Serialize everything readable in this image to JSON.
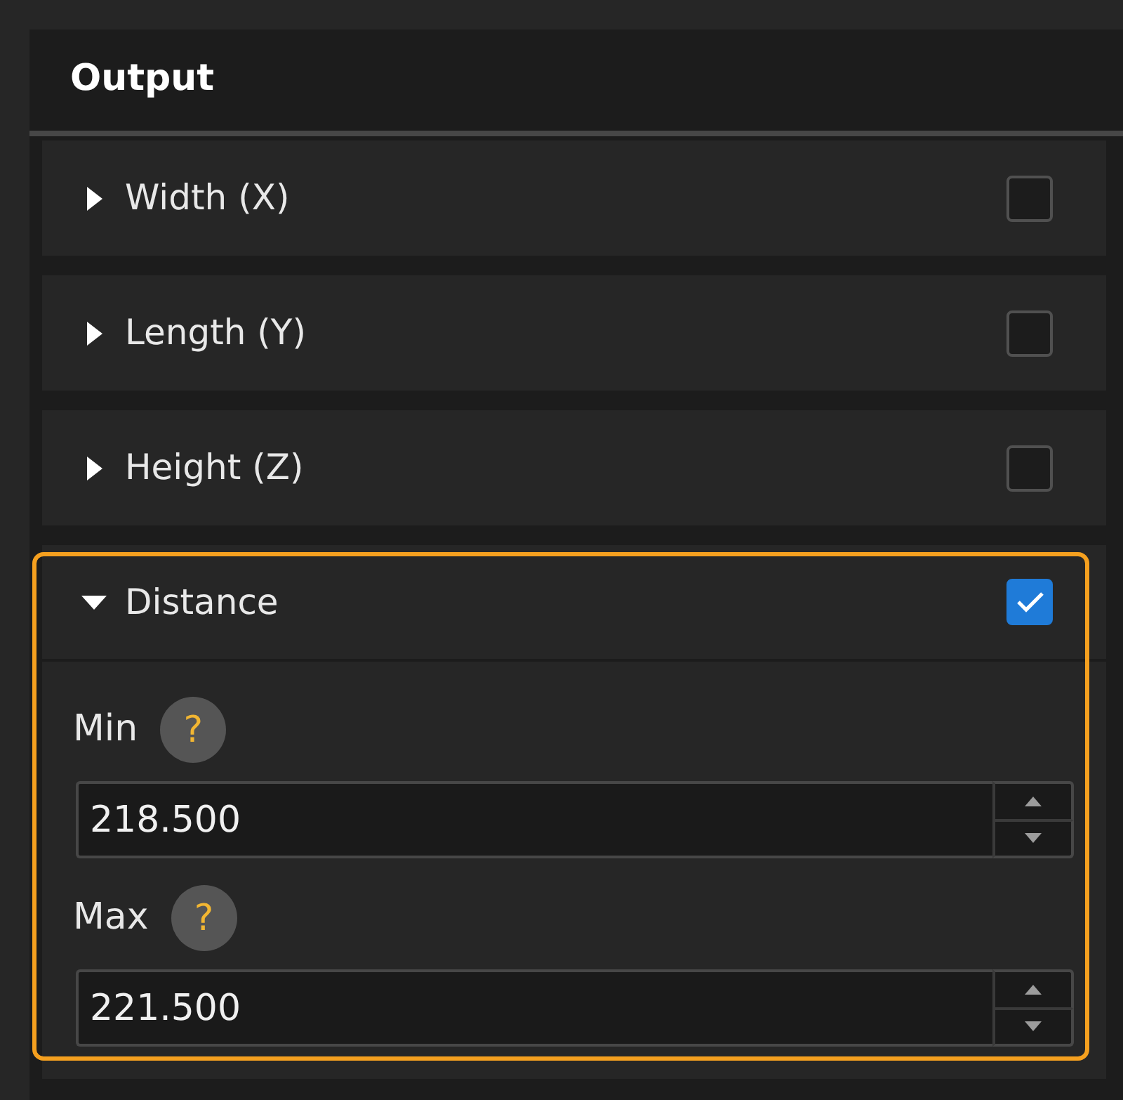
{
  "panel": {
    "title": "Output"
  },
  "sections": [
    {
      "label": "Width (X)",
      "expanded": false,
      "checked": false,
      "highlighted": false
    },
    {
      "label": "Length (Y)",
      "expanded": false,
      "checked": false,
      "highlighted": false
    },
    {
      "label": "Height (Z)",
      "expanded": false,
      "checked": false,
      "highlighted": false
    },
    {
      "label": "Distance",
      "expanded": true,
      "checked": true,
      "highlighted": true,
      "fields": [
        {
          "label": "Min",
          "help": "?",
          "value": "218.500"
        },
        {
          "label": "Max",
          "help": "?",
          "value": "221.500"
        }
      ]
    }
  ]
}
